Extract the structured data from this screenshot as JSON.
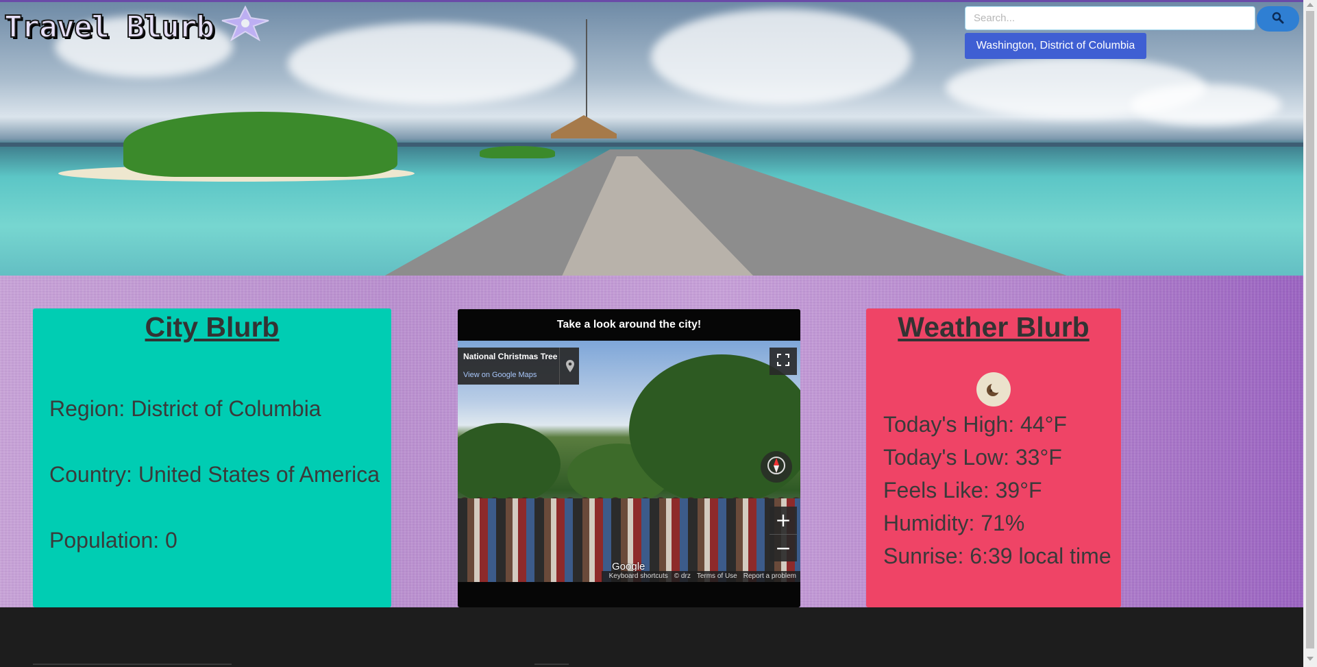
{
  "header": {
    "logo_text": "Travel Blurb",
    "search": {
      "placeholder": "Search...",
      "value": ""
    },
    "recent_search_label": "Washington, District of Columbia"
  },
  "city_card": {
    "title": "City Blurb",
    "region": "Region: District of Columbia",
    "country": "Country: United States of America",
    "population": "Population: 0"
  },
  "map_card": {
    "header": "Take a look around the city!",
    "place_name": "National Christmas Tree",
    "view_link": "View on Google Maps",
    "google_logo": "Google",
    "attribution": [
      "Keyboard shortcuts",
      "© drz",
      "Terms of Use",
      "Report a problem"
    ]
  },
  "weather_card": {
    "title": "Weather Blurb",
    "icon": "moon-icon",
    "high": "Today's High: 44°F",
    "low": "Today's Low: 33°F",
    "feels_like": "Feels Like: 39°F",
    "humidity": "Humidity: 71%",
    "sunrise": "Sunrise: 6:39 local time"
  },
  "colors": {
    "city_card": "#00cdb3",
    "weather_card": "#ef4466",
    "search_button": "#2f7fd3",
    "recent_button": "#3f5fd3"
  }
}
